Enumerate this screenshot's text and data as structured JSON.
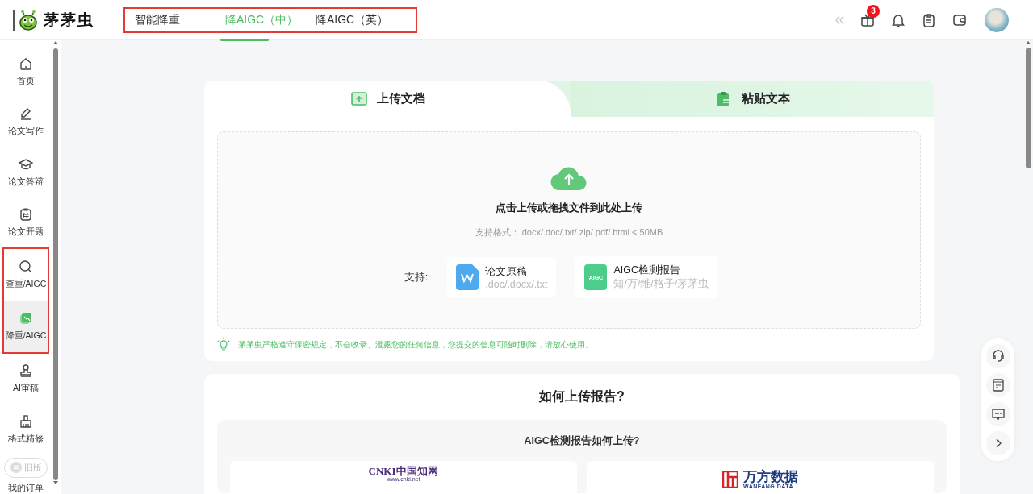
{
  "app": {
    "name": "茅茅虫"
  },
  "header_tabs": {
    "highlighted": true,
    "items": [
      {
        "label": "智能降重",
        "selected": false
      },
      {
        "label": "降AIGC（中）",
        "selected": true
      },
      {
        "label": "降AIGC（英）",
        "selected": false
      }
    ]
  },
  "header_actions": {
    "badge": "3"
  },
  "sidebar": {
    "items": [
      {
        "label": "首页",
        "selected": false,
        "highlighted": false
      },
      {
        "label": "论文写作",
        "selected": false,
        "highlighted": false
      },
      {
        "label": "论文答辩",
        "selected": false,
        "highlighted": false
      },
      {
        "label": "论文开题",
        "selected": false,
        "highlighted": false
      },
      {
        "label": "查重/AIGC",
        "selected": false,
        "highlighted": true
      },
      {
        "label": "降重/AIGC",
        "selected": true,
        "highlighted": true
      },
      {
        "label": "AI审稿",
        "selected": false,
        "highlighted": false
      },
      {
        "label": "格式精修",
        "selected": false,
        "highlighted": false
      }
    ],
    "old_version": "旧版",
    "orders": "我的订单"
  },
  "upload": {
    "tabs": [
      {
        "label": "上传文档",
        "selected": true
      },
      {
        "label": "粘贴文本",
        "selected": false
      }
    ],
    "prompt": "点击上传或拖拽文件到此处上传",
    "formats": "支持格式：.docx/.doc/.txt/.zip/.pdf/.html < 50MB",
    "support_label": "支持:",
    "supported": [
      {
        "kind": "word",
        "title": "论文原稿",
        "detail": ".doc/.docx/.txt"
      },
      {
        "kind": "aigc",
        "icon_text": "AIGC",
        "title": "AIGC检测报告",
        "detail": "知/万/维/格子/茅茅虫"
      }
    ],
    "notice": "茅茅虫严格遵守保密规定，不会收录、泄露您的任何信息，您提交的信息可随时删除，请放心使用。"
  },
  "guide": {
    "title": "如何上传报告?",
    "subtitle": "AIGC检测报告如何上传?",
    "sources": [
      {
        "kind": "cnki",
        "name": "中国知网",
        "url": "www.cnki.net",
        "mark": "CNKI"
      },
      {
        "kind": "wanfang",
        "name": "万方数据",
        "mark": "WANFANG DATA"
      }
    ]
  }
}
